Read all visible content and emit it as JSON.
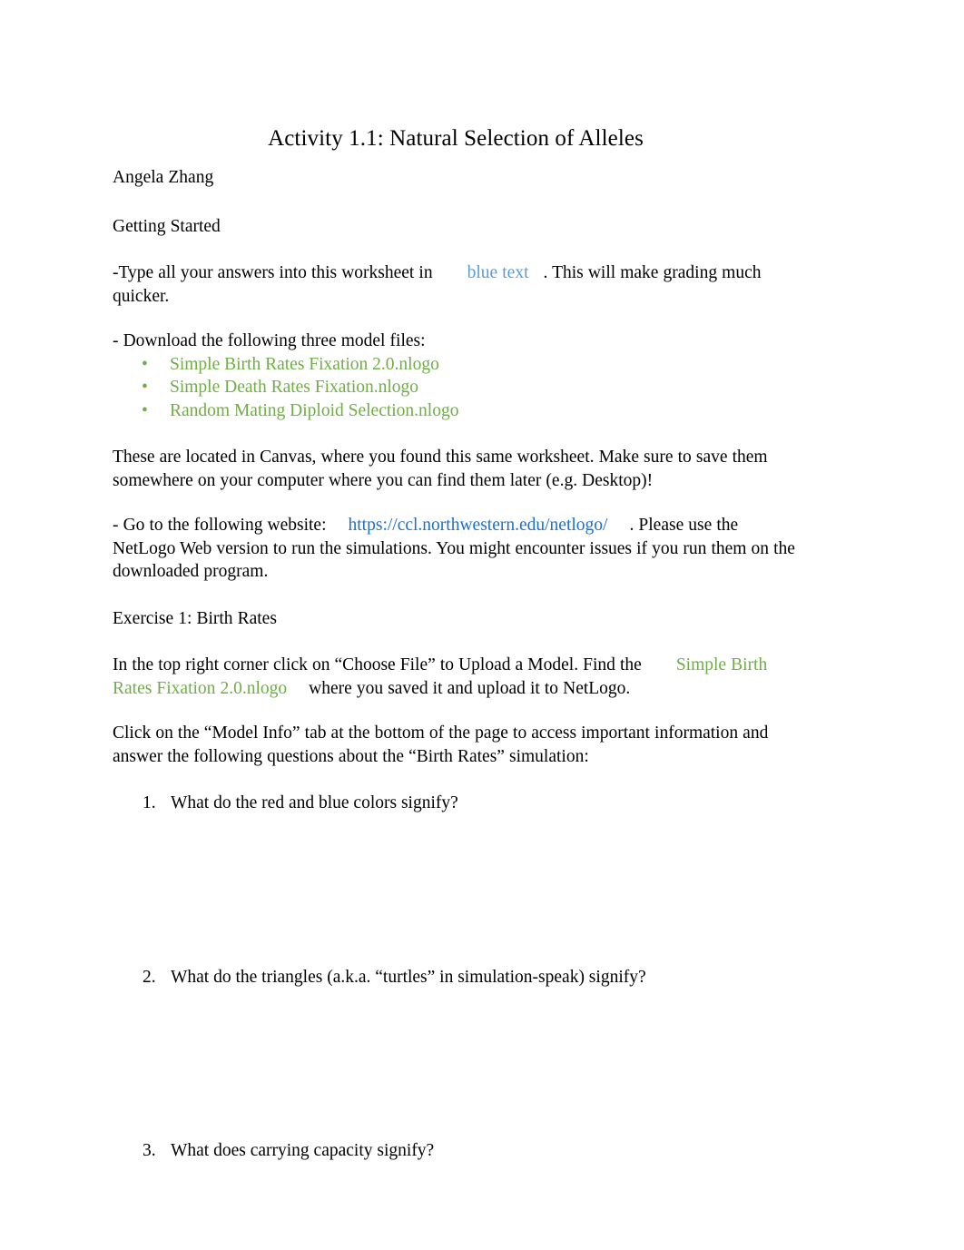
{
  "document": {
    "title": "Activity 1.1: Natural Selection of Alleles",
    "author": "Angela Zhang",
    "section_getting_started": "Getting Started",
    "instruction_type_answers": {
      "before": "-Type all your answers into this worksheet in",
      "highlight": "blue text",
      "after": ". This will make grading much quicker."
    },
    "instruction_download": "- Download the following three model files:",
    "model_files": [
      {
        "bullet": "•",
        "name": "Simple Birth Rates Fixation 2.0.nlogo"
      },
      {
        "bullet": "•",
        "name": "Simple Death Rates Fixation.nlogo"
      },
      {
        "bullet": "•",
        "name": "Random Mating Diploid Selection.nlogo"
      }
    ],
    "canvas_note": "These are located in Canvas, where you found this same worksheet. Make sure to save them somewhere on your computer where you can find them later (e.g. Desktop)!",
    "website_instruction": {
      "before": "- Go to the following website:",
      "url": "https://ccl.northwestern.edu/netlogo/",
      "after": ". Please use the NetLogo Web version to run the simulations. You might encounter issues if you run them on the downloaded program."
    },
    "exercise_heading": "Exercise 1: Birth Rates",
    "upload_instruction": {
      "before": "In the top right corner click on “Choose File” to Upload a Model. Find the",
      "file": "Simple Birth Rates Fixation 2.0.nlogo",
      "after": "where you saved it and upload it to NetLogo."
    },
    "model_info_instruction": "Click on the “Model Info” tab at the bottom of the page to access important information and answer the following questions about the “Birth Rates” simulation:",
    "questions": [
      {
        "number": "1.",
        "text": "What do the red and blue colors signify?",
        "answer": ""
      },
      {
        "number": "2.",
        "text": "What do the triangles (a.k.a. “turtles” in simulation-speak) signify?",
        "answer": ""
      },
      {
        "number": "3.",
        "text": "What does carrying capacity signify?",
        "answer": ""
      }
    ]
  },
  "colors": {
    "page_background": "#ffffff",
    "body_text": "#000000",
    "highlight_blue": "#5b9bd5",
    "link_blue": "#1f6fc4",
    "accent_green": "#70ad47"
  }
}
